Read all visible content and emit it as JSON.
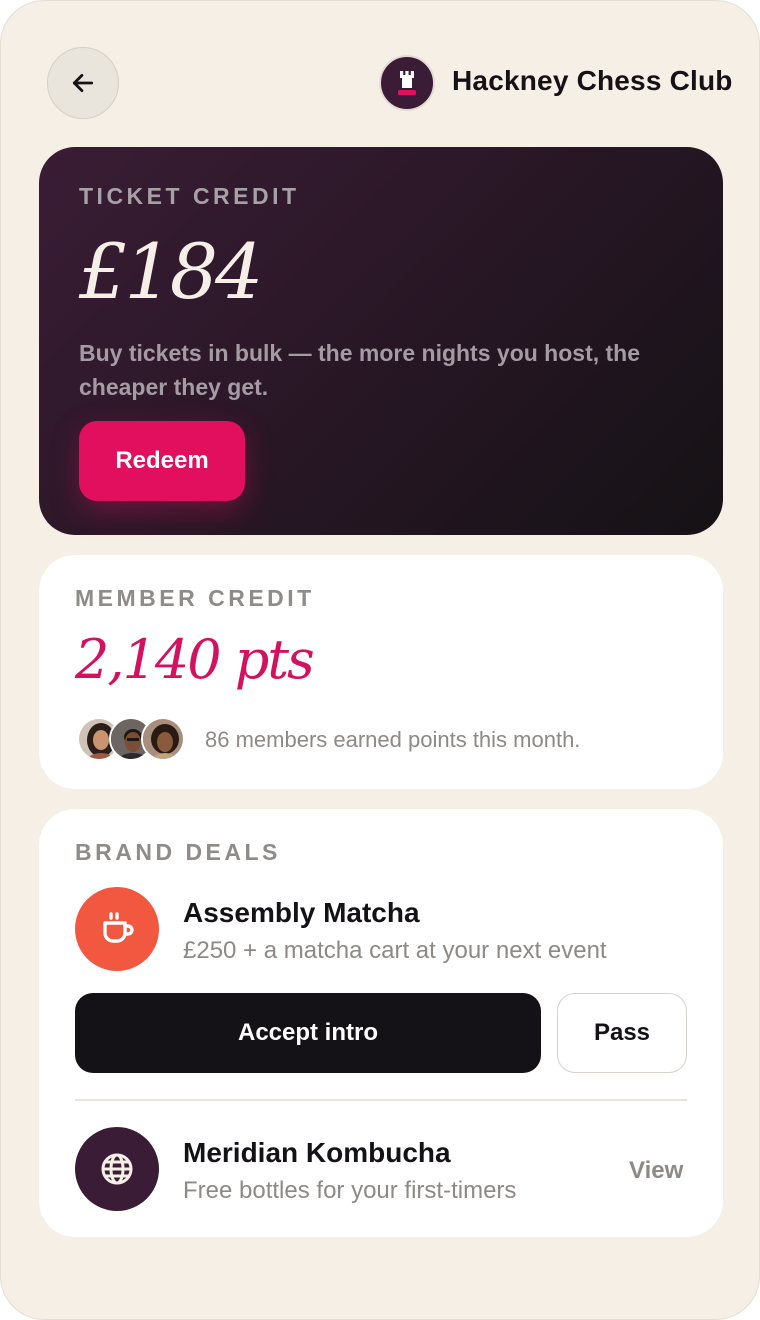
{
  "header": {
    "back_icon": "arrow-left-icon",
    "club_logo_icon": "chess-rook-icon",
    "club_name": "Hackney Chess Club"
  },
  "ticket_credit": {
    "label": "TICKET CREDIT",
    "amount": "£184",
    "description": "Buy tickets in bulk — the more nights you host, the cheaper they get.",
    "redeem_label": "Redeem"
  },
  "member_credit": {
    "label": "MEMBER CREDIT",
    "points": "2,140 pts",
    "members_text": "86 members earned points this month."
  },
  "brand_deals": {
    "label": "BRAND DEALS",
    "deals": [
      {
        "name": "Assembly Matcha",
        "subtitle": "£250 + a matcha cart at your next event",
        "icon": "coffee-cup-icon",
        "icon_bg": "#f2573f",
        "accept_label": "Accept intro",
        "pass_label": "Pass"
      },
      {
        "name": "Meridian Kombucha",
        "subtitle": "Free bottles for your first-timers",
        "icon": "globe-icon",
        "icon_bg": "#3a1c36",
        "view_label": "View"
      }
    ]
  },
  "colors": {
    "background": "#f5efe6",
    "accent": "#e10f5e",
    "ticket_card": "#2a1727"
  }
}
